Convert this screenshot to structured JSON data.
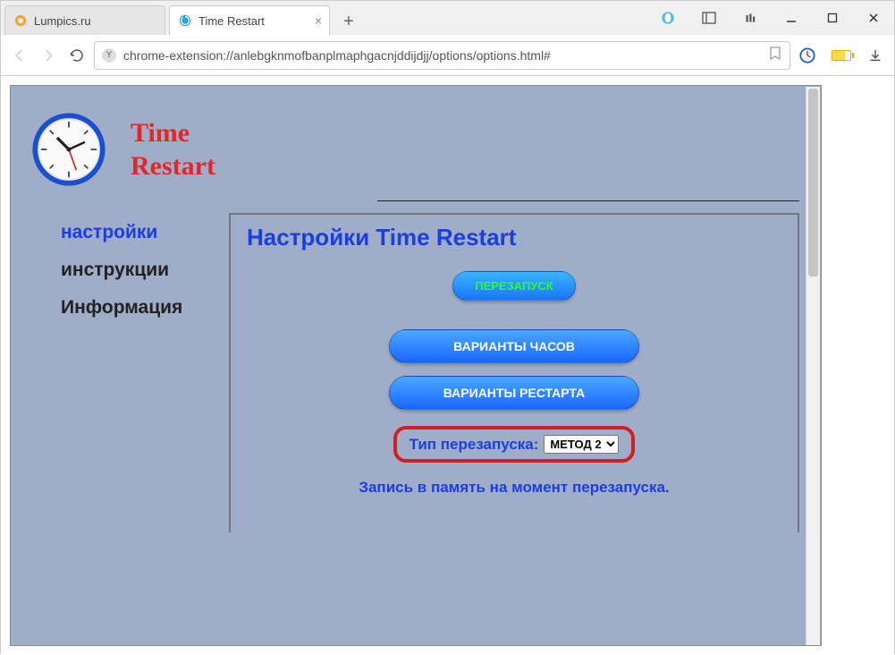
{
  "tabs": [
    {
      "title": "Lumpics.ru",
      "favicon_color": "#f7a13a"
    },
    {
      "title": "Time Restart",
      "favicon_color": "#2aa3e0"
    }
  ],
  "url": "chrome-extension://anlebgknmofbanplmaphgacnjddijdjj/options/options.html#",
  "app": {
    "title_line1": "Time",
    "title_line2": "Restart"
  },
  "sidebar": {
    "items": [
      {
        "label": "настройки",
        "selected": true
      },
      {
        "label": "инструкции",
        "selected": false
      },
      {
        "label": "Информация",
        "selected": false
      }
    ]
  },
  "panel": {
    "heading": "Настройки Time Restart",
    "restart_button": "ПЕРЕЗАПУСК",
    "clock_variants_button": "ВАРИАНТЫ ЧАСОВ",
    "restart_variants_button": "ВАРИАНТЫ РЕСТАРТА",
    "restart_type_label": "Тип перезапуска:",
    "restart_type_value": "МЕТОД 2",
    "memory_note": "Запись в память на момент перезапуска."
  }
}
